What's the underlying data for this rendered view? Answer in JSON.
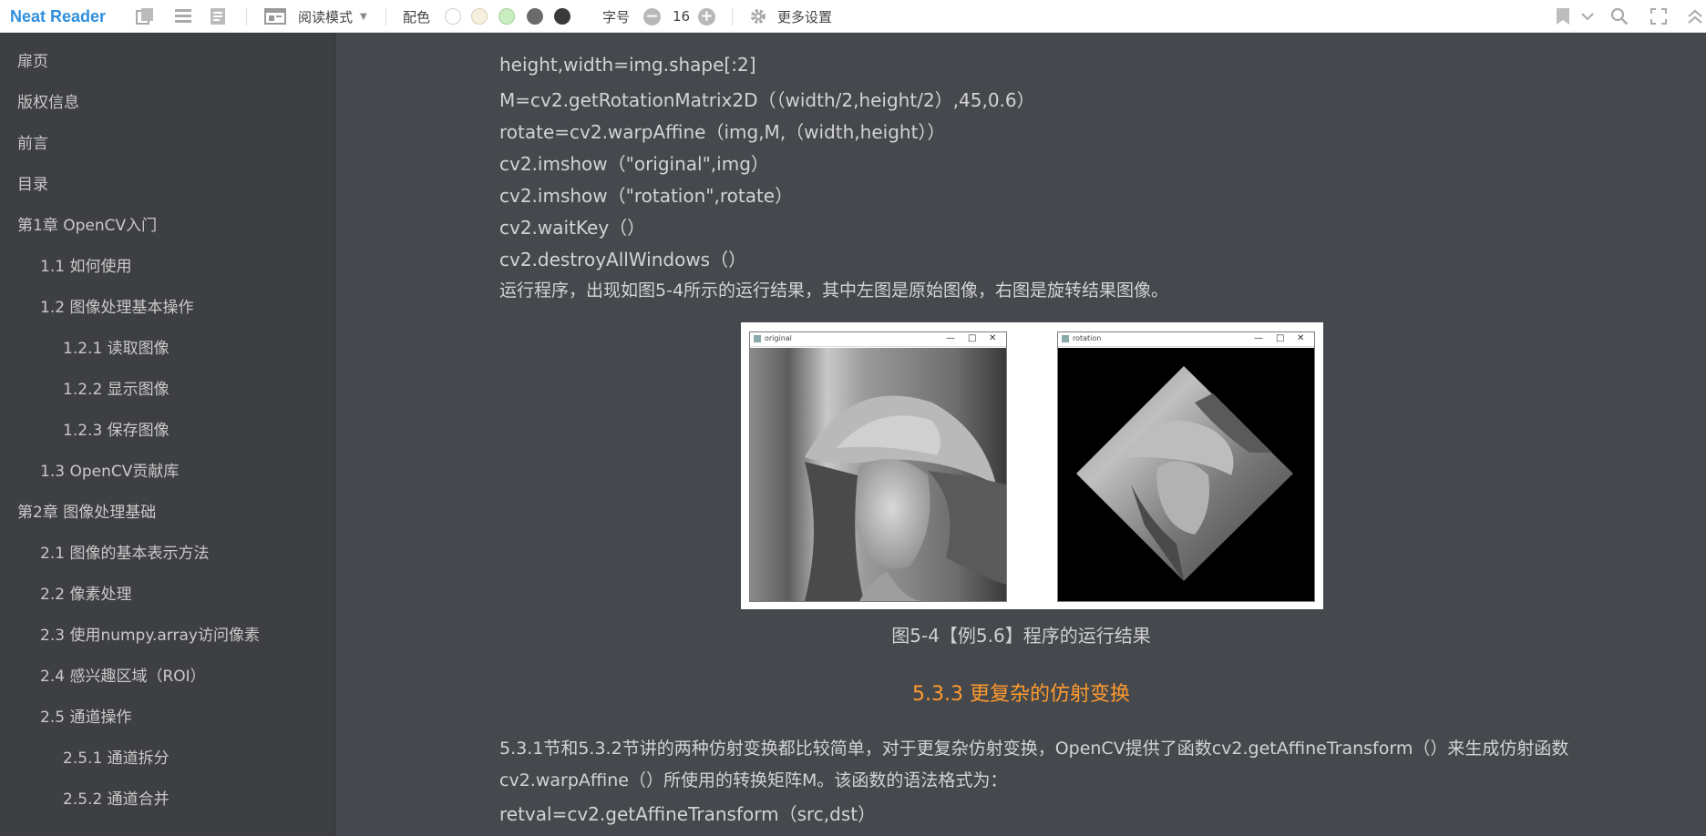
{
  "toolbar": {
    "app_name": "Neat Reader",
    "reading_mode_label": "阅读模式",
    "color_label": "配色",
    "font_size_label": "字号",
    "font_size_value": "16",
    "minus_symbol": "−",
    "plus_symbol": "+",
    "more_settings_label": "更多设置",
    "swatches": [
      "#ffffff",
      "#f7f0df",
      "#c9ecc0",
      "#6a6a6a",
      "#3a3a3a"
    ]
  },
  "sidebar": {
    "items": [
      {
        "label": "扉页",
        "level": 0
      },
      {
        "label": "版权信息",
        "level": 0
      },
      {
        "label": "前言",
        "level": 0
      },
      {
        "label": "目录",
        "level": 0
      },
      {
        "label": "第1章 OpenCV入门",
        "level": 0
      },
      {
        "label": "1.1 如何使用",
        "level": 1
      },
      {
        "label": "1.2 图像处理基本操作",
        "level": 1
      },
      {
        "label": "1.2.1 读取图像",
        "level": 2
      },
      {
        "label": "1.2.2 显示图像",
        "level": 2
      },
      {
        "label": "1.2.3 保存图像",
        "level": 2
      },
      {
        "label": "1.3 OpenCV贡献库",
        "level": 1
      },
      {
        "label": "第2章 图像处理基础",
        "level": 0
      },
      {
        "label": "2.1 图像的基本表示方法",
        "level": 1
      },
      {
        "label": "2.2 像素处理",
        "level": 1
      },
      {
        "label": "2.3 使用numpy.array访问像素",
        "level": 1
      },
      {
        "label": "2.4 感兴趣区域（ROI）",
        "level": 1
      },
      {
        "label": "2.5 通道操作",
        "level": 1
      },
      {
        "label": "2.5.1 通道拆分",
        "level": 2
      },
      {
        "label": "2.5.2 通道合并",
        "level": 2
      }
    ]
  },
  "content": {
    "code_lines": [
      "height,width=img.shape[:2]",
      "M=cv2.getRotationMatrix2D（（width/2,height/2）,45,0.6）",
      "rotate=cv2.warpAffine（img,M,（width,height））",
      "cv2.imshow（\"original\",img）",
      "cv2.imshow（\"rotation\",rotate）",
      "cv2.waitKey（）",
      "cv2.destroyAllWindows（）"
    ],
    "run_text": "运行程序，出现如图5-4所示的运行结果，其中左图是原始图像，右图是旋转结果图像。",
    "figure": {
      "left_window_title": "original",
      "right_window_title": "rotation"
    },
    "caption": "图5-4【例5.6】程序的运行结果",
    "section_title": "5.3.3 更复杂的仿射变换",
    "paragraph": "5.3.1节和5.3.2节讲的两种仿射变换都比较简单，对于更复杂仿射变换，OpenCV提供了函数cv2.getAffineTransform（）来生成仿射函数cv2.warpAffine（）所使用的转换矩阵M。该函数的语法格式为：",
    "syntax_line": "retval=cv2.getAffineTransform（src,dst）"
  },
  "colors": {
    "accent": "#2f8fdd",
    "section_title": "#ff9a2e",
    "background": "#45484c",
    "sidebar": "#3d3f42"
  }
}
